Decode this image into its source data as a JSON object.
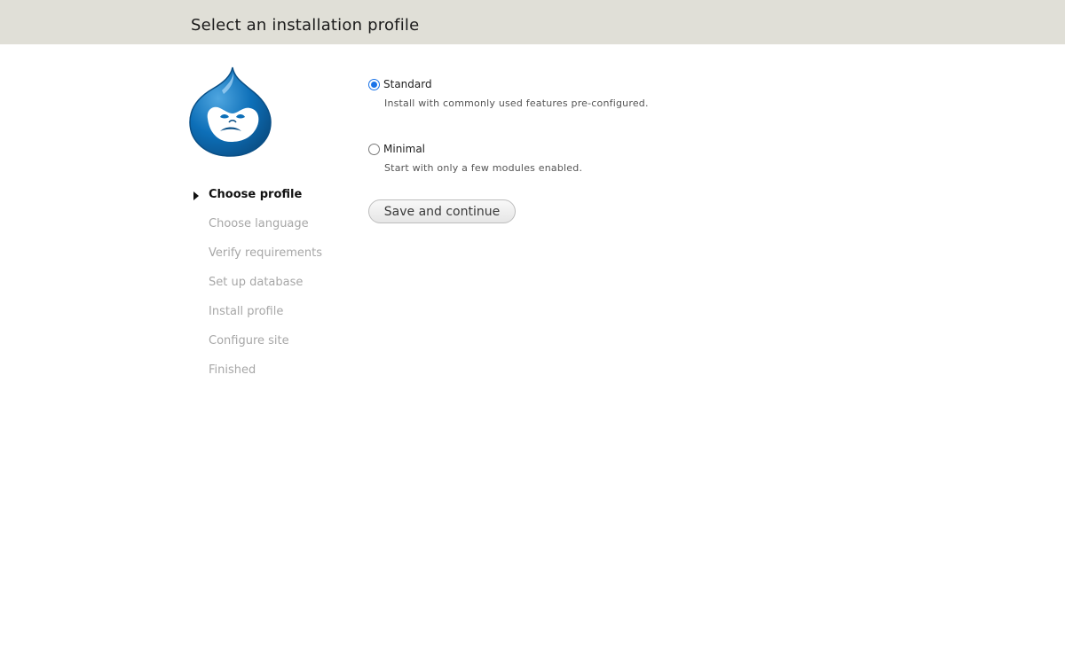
{
  "header": {
    "title": "Select an installation profile"
  },
  "logo": {
    "icon": "drupal-drop-logo",
    "colors": {
      "primary": "#0d6fb8",
      "dark": "#0a4f86",
      "light": "#4fa6e0"
    }
  },
  "steps": {
    "items": [
      {
        "label": "Choose profile",
        "active": true
      },
      {
        "label": "Choose language",
        "active": false
      },
      {
        "label": "Verify requirements",
        "active": false
      },
      {
        "label": "Set up database",
        "active": false
      },
      {
        "label": "Install profile",
        "active": false
      },
      {
        "label": "Configure site",
        "active": false
      },
      {
        "label": "Finished",
        "active": false
      }
    ]
  },
  "profiles": {
    "options": [
      {
        "label": "Standard",
        "description": "Install with commonly used features pre-configured.",
        "checked": true
      },
      {
        "label": "Minimal",
        "description": "Start with only a few modules enabled.",
        "checked": false
      }
    ],
    "submit_label": "Save and continue"
  },
  "colors": {
    "header_bg": "#e0dfd7",
    "radio_accent": "#1a73e8",
    "inactive_step": "#a7a7a7"
  }
}
